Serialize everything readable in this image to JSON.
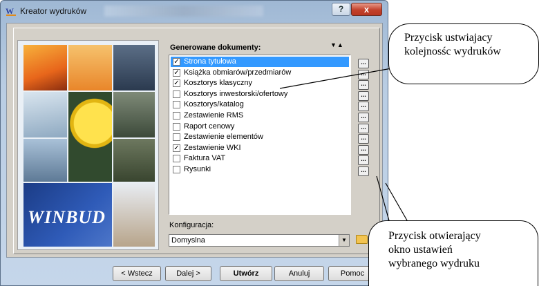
{
  "window": {
    "title": "Kreator wydruków",
    "help_label": "?",
    "close_label": "x",
    "logo_text": "WINBUD"
  },
  "documents": {
    "header": "Generowane dokumenty:",
    "sort_arrows": "▼▲",
    "items": [
      {
        "label": "Strona tytułowa",
        "checked": true,
        "selected": true
      },
      {
        "label": "Książka obmiarów/przedmiarów",
        "checked": true,
        "selected": false
      },
      {
        "label": "Kosztorys klasyczny",
        "checked": true,
        "selected": false
      },
      {
        "label": "Kosztorys inwestorski/ofertowy",
        "checked": false,
        "selected": false
      },
      {
        "label": "Kosztorys/katalog",
        "checked": false,
        "selected": false
      },
      {
        "label": "Zestawienie RMS",
        "checked": false,
        "selected": false
      },
      {
        "label": "Raport cenowy",
        "checked": false,
        "selected": false
      },
      {
        "label": "Zestawienie elementów",
        "checked": false,
        "selected": false
      },
      {
        "label": "Zestawienie WKI",
        "checked": true,
        "selected": false
      },
      {
        "label": "Faktura VAT",
        "checked": false,
        "selected": false
      },
      {
        "label": "Rysunki",
        "checked": false,
        "selected": false
      }
    ],
    "settings_button_label": "..."
  },
  "configuration": {
    "label": "Konfiguracja:",
    "value": "Domyslna"
  },
  "buttons": {
    "back": "< Wstecz",
    "next": "Dalej >",
    "create": "Utwórz",
    "cancel": "Anuluj",
    "help": "Pomoc"
  },
  "callouts": {
    "top_line1": "Przycisk ustwiajacy",
    "top_line2": "kolejnosśc wydruków",
    "bottom_line1": "Przycisk otwierający",
    "bottom_line2": "okno ustawień",
    "bottom_line3": "wybranego wydruku"
  }
}
